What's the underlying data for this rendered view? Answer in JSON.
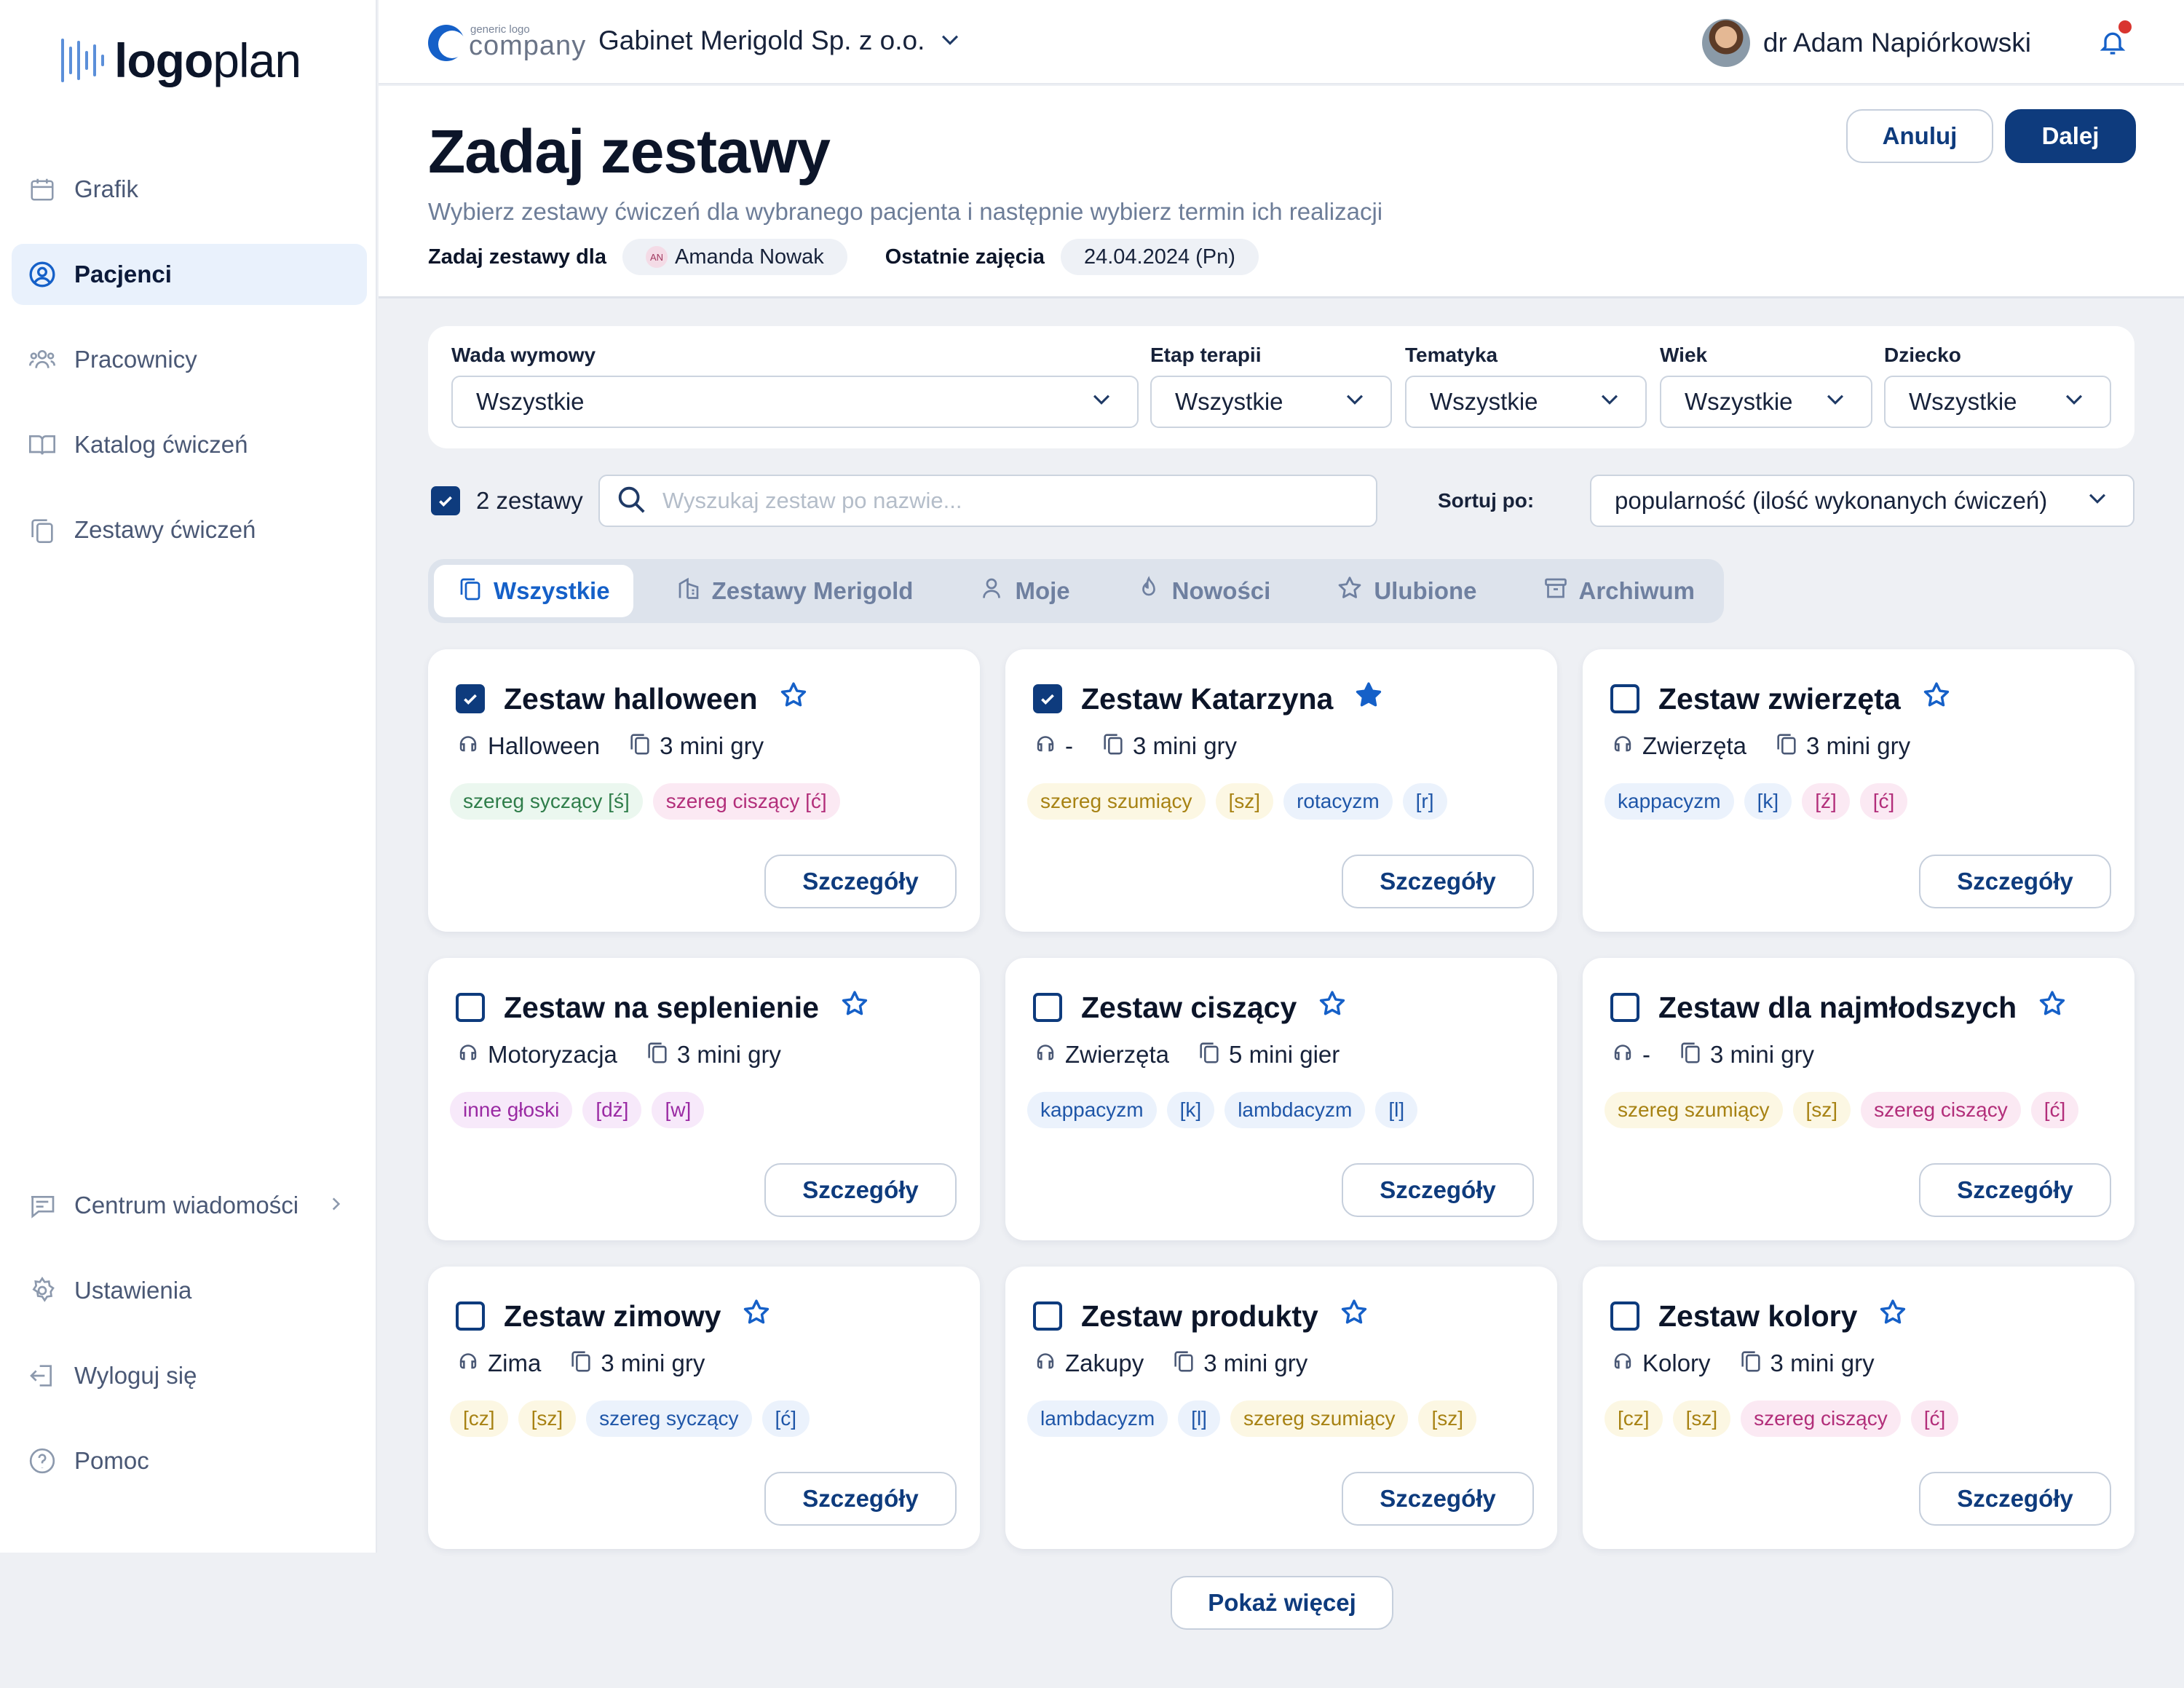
{
  "app": {
    "logo_bold": "logo",
    "logo_light": "plan"
  },
  "sidebar": {
    "items": [
      {
        "label": "Grafik",
        "icon": "calendar-icon"
      },
      {
        "label": "Pacjenci",
        "icon": "user-circle-icon",
        "active": true
      },
      {
        "label": "Pracownicy",
        "icon": "team-icon"
      },
      {
        "label": "Katalog ćwiczeń",
        "icon": "book-icon"
      },
      {
        "label": "Zestawy ćwiczeń",
        "icon": "copy-icon"
      }
    ],
    "bottom_items": [
      {
        "label": "Centrum wiadomości",
        "icon": "message-icon"
      },
      {
        "label": "Ustawienia",
        "icon": "gear-icon"
      },
      {
        "label": "Wyloguj się",
        "icon": "logout-icon"
      },
      {
        "label": "Pomoc",
        "icon": "help-icon"
      }
    ]
  },
  "header": {
    "company_logo_small": "generic logo",
    "company_logo_big": "company",
    "company_name": "Gabinet Merigold Sp. z o.o.",
    "user_name": "dr Adam Napiórkowski"
  },
  "page": {
    "title": "Zadaj zestawy",
    "subtitle": "Wybierz zestawy ćwiczeń dla wybranego pacjenta i następnie wybierz termin ich realizacji",
    "assign_label": "Zadaj zestawy dla",
    "patient_initials": "AN",
    "patient_name": "Amanda Nowak",
    "last_label": "Ostatnie zajęcia",
    "last_date": "24.04.2024 (Pn)",
    "cancel_label": "Anuluj",
    "next_label": "Dalej"
  },
  "filters": [
    {
      "label": "Wada wymowy",
      "value": "Wszystkie"
    },
    {
      "label": "Etap terapii",
      "value": "Wszystkie"
    },
    {
      "label": "Tematyka",
      "value": "Wszystkie"
    },
    {
      "label": "Wiek",
      "value": "Wszystkie"
    },
    {
      "label": "Dziecko",
      "value": "Wszystkie"
    }
  ],
  "toolbar": {
    "selected_count": "2 zestawy",
    "search_placeholder": "Wyszukaj zestaw po nazwie...",
    "sort_label": "Sortuj po:",
    "sort_value": "popularność (ilość wykonanych ćwiczeń)"
  },
  "tabs": [
    {
      "label": "Wszystkie",
      "icon": "copy-icon",
      "active": true
    },
    {
      "label": "Zestawy Merigold",
      "icon": "building-icon"
    },
    {
      "label": "Moje",
      "icon": "user-icon"
    },
    {
      "label": "Nowości",
      "icon": "flame-icon"
    },
    {
      "label": "Ulubione",
      "icon": "star-icon"
    },
    {
      "label": "Archiwum",
      "icon": "archive-icon"
    }
  ],
  "details_label": "Szczegóły",
  "show_more_label": "Pokaż więcej",
  "colors": {
    "primary": "#0e3b7d",
    "accent": "#1560c8",
    "notification": "#d9352f"
  },
  "cards": [
    {
      "title": "Zestaw halloween",
      "checked": true,
      "favorite": false,
      "theme": "Halloween",
      "games": "3 mini gry",
      "tags": [
        {
          "text": "szereg syczący [ś]",
          "color": "green"
        },
        {
          "text": "szereg ciszący [ć]",
          "color": "pink"
        }
      ]
    },
    {
      "title": "Zestaw Katarzyna",
      "checked": true,
      "favorite": true,
      "theme": "-",
      "games": "3 mini gry",
      "tags": [
        {
          "text": "szereg szumiący",
          "color": "yellow"
        },
        {
          "text": "[sz]",
          "color": "yellow"
        },
        {
          "text": "rotacyzm",
          "color": "blue"
        },
        {
          "text": "[r]",
          "color": "blue"
        }
      ]
    },
    {
      "title": "Zestaw zwierzęta",
      "checked": false,
      "favorite": false,
      "theme": "Zwierzęta",
      "games": "3 mini gry",
      "tags": [
        {
          "text": "kappacyzm",
          "color": "blue"
        },
        {
          "text": "[k]",
          "color": "blue"
        },
        {
          "text": "[ź]",
          "color": "pink"
        },
        {
          "text": "[ć]",
          "color": "pink"
        }
      ]
    },
    {
      "title": "Zestaw na seplenienie",
      "checked": false,
      "favorite": false,
      "theme": "Motoryzacja",
      "games": "3 mini gry",
      "tags": [
        {
          "text": "inne głoski",
          "color": "purple"
        },
        {
          "text": "[dż]",
          "color": "purple"
        },
        {
          "text": "[w]",
          "color": "purple"
        }
      ]
    },
    {
      "title": "Zestaw ciszący",
      "checked": false,
      "favorite": false,
      "theme": "Zwierzęta",
      "games": "5 mini gier",
      "tags": [
        {
          "text": "kappacyzm",
          "color": "blue"
        },
        {
          "text": "[k]",
          "color": "blue"
        },
        {
          "text": "lambdacyzm",
          "color": "blue"
        },
        {
          "text": "[l]",
          "color": "blue"
        }
      ]
    },
    {
      "title": "Zestaw dla najmłodszych",
      "checked": false,
      "favorite": false,
      "theme": "-",
      "games": "3 mini gry",
      "tags": [
        {
          "text": "szereg szumiący",
          "color": "yellow"
        },
        {
          "text": "[sz]",
          "color": "yellow"
        },
        {
          "text": "szereg ciszący",
          "color": "pink"
        },
        {
          "text": "[ć]",
          "color": "pink"
        }
      ]
    },
    {
      "title": "Zestaw zimowy",
      "checked": false,
      "favorite": false,
      "theme": "Zima",
      "games": "3 mini gry",
      "tags": [
        {
          "text": "[cz]",
          "color": "yellow"
        },
        {
          "text": "[sz]",
          "color": "yellow"
        },
        {
          "text": "szereg syczący",
          "color": "blue"
        },
        {
          "text": "[ć]",
          "color": "blue"
        }
      ]
    },
    {
      "title": "Zestaw produkty",
      "checked": false,
      "favorite": false,
      "theme": "Zakupy",
      "games": "3 mini gry",
      "tags": [
        {
          "text": "lambdacyzm",
          "color": "blue"
        },
        {
          "text": "[l]",
          "color": "blue"
        },
        {
          "text": "szereg szumiący",
          "color": "yellow"
        },
        {
          "text": "[sz]",
          "color": "yellow"
        }
      ]
    },
    {
      "title": "Zestaw kolory",
      "checked": false,
      "favorite": false,
      "theme": "Kolory",
      "games": "3 mini gry",
      "tags": [
        {
          "text": "[cz]",
          "color": "yellow"
        },
        {
          "text": "[sz]",
          "color": "yellow"
        },
        {
          "text": "szereg ciszący",
          "color": "pink"
        },
        {
          "text": "[ć]",
          "color": "pink"
        }
      ]
    }
  ]
}
